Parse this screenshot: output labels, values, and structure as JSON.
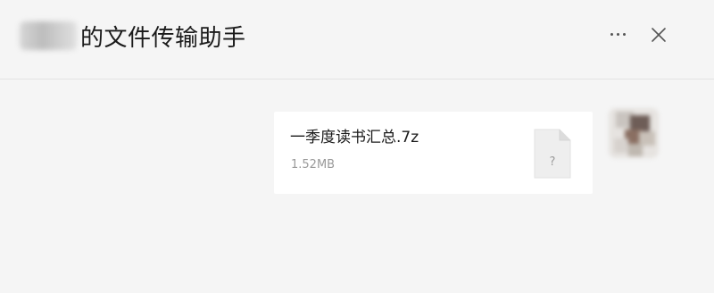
{
  "header": {
    "title": "的文件传输助手",
    "more_icon": "more-horizontal-icon",
    "close_icon": "close-icon"
  },
  "message": {
    "file_name": "一季度读书汇总.7z",
    "file_size": "1.52MB",
    "file_icon_glyph": "?",
    "file_icon": "unknown-file-icon"
  },
  "colors": {
    "background": "#f5f5f5",
    "card": "#ffffff",
    "title_text": "#1a1a1a",
    "secondary_text": "#9a9a9a"
  }
}
